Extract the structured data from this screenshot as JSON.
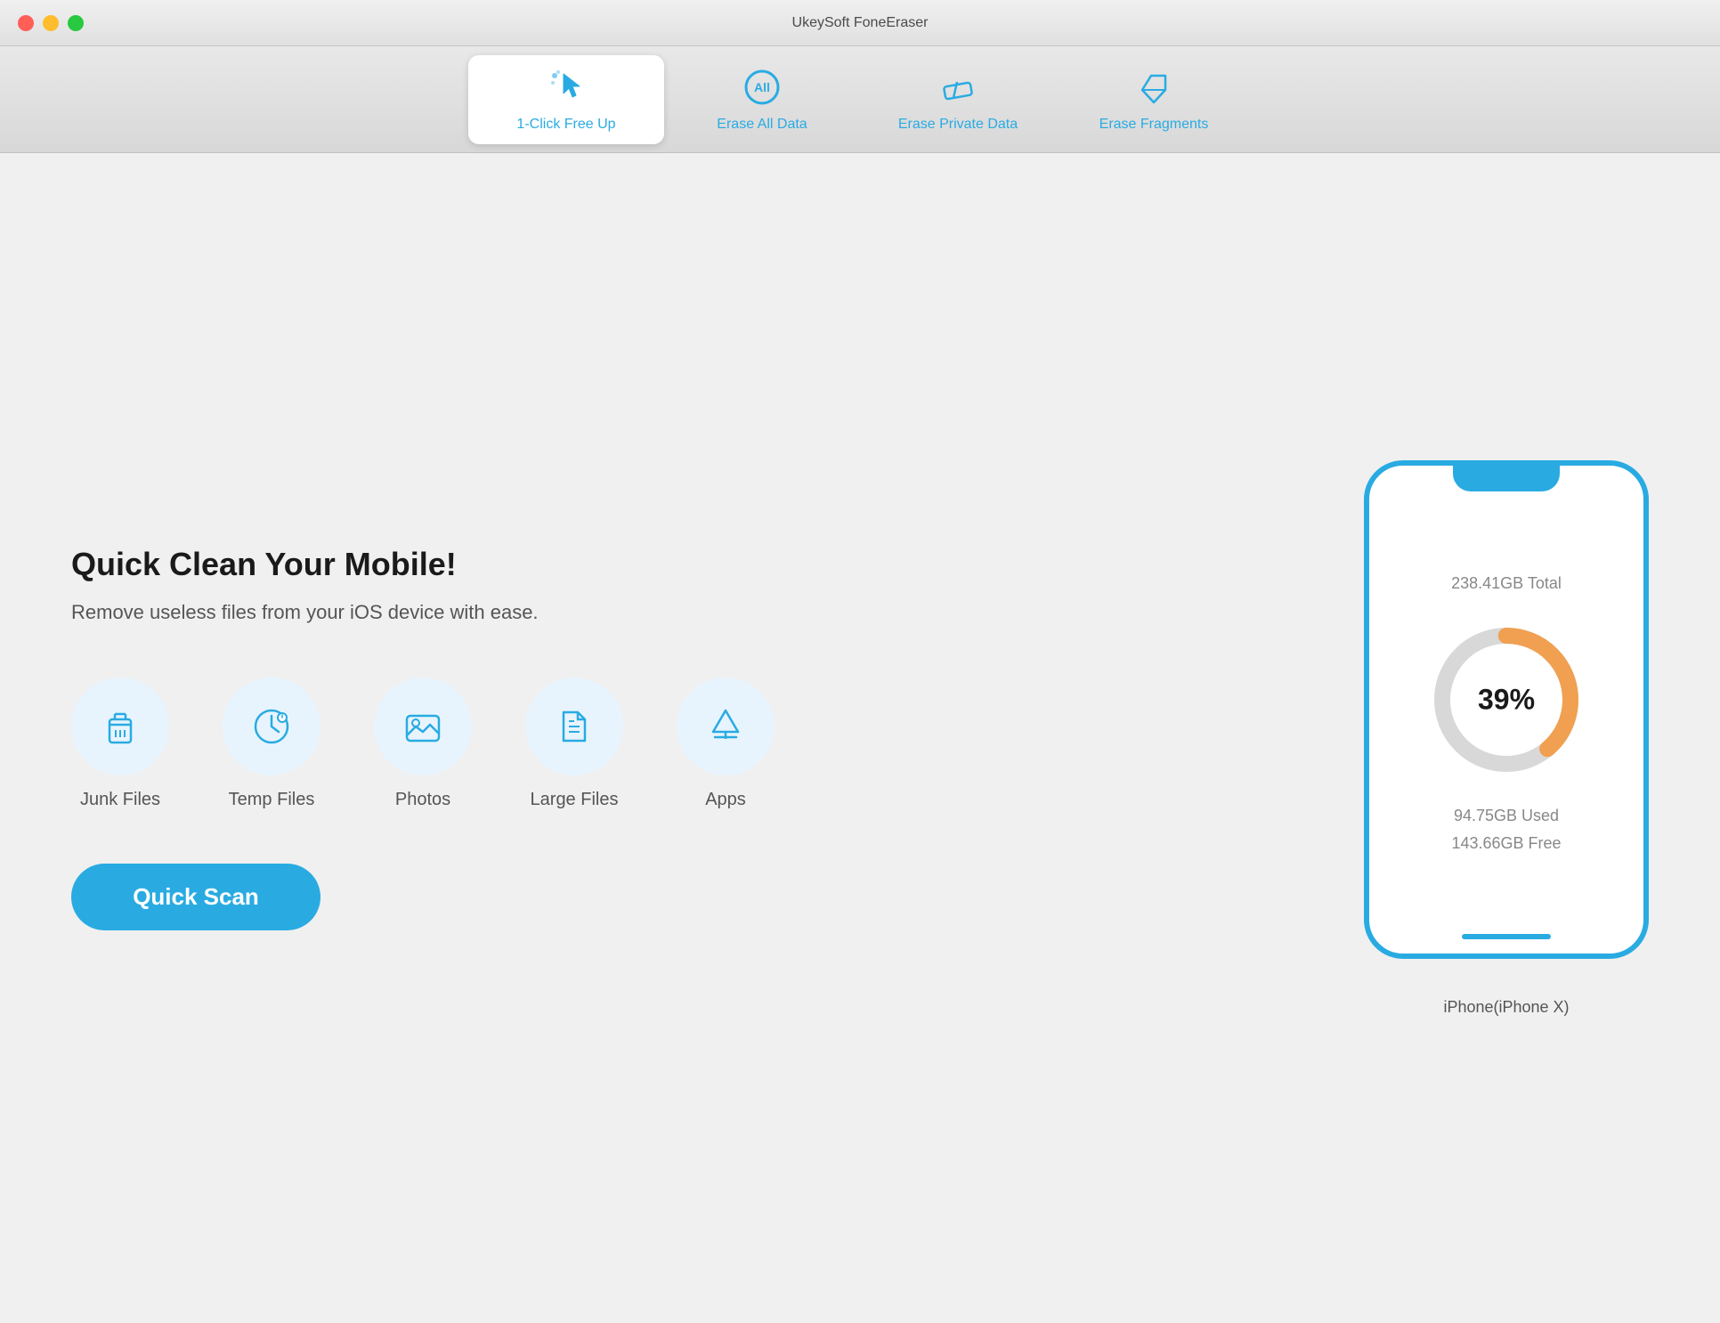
{
  "window": {
    "title": "UkeySoft FoneEraser"
  },
  "titlebar": {
    "close_label": "",
    "minimize_label": "",
    "maximize_label": ""
  },
  "nav": {
    "tabs": [
      {
        "id": "one-click",
        "label": "1-Click Free Up",
        "active": true
      },
      {
        "id": "erase-all",
        "label": "Erase All Data",
        "active": false
      },
      {
        "id": "erase-private",
        "label": "Erase Private Data",
        "active": false
      },
      {
        "id": "erase-fragments",
        "label": "Erase Fragments",
        "active": false
      }
    ]
  },
  "main": {
    "headline": "Quick Clean Your Mobile!",
    "subtitle": "Remove useless files from your iOS device with ease.",
    "icons": [
      {
        "id": "junk-files",
        "label": "Junk Files"
      },
      {
        "id": "temp-files",
        "label": "Temp Files"
      },
      {
        "id": "photos",
        "label": "Photos"
      },
      {
        "id": "large-files",
        "label": "Large Files"
      },
      {
        "id": "apps",
        "label": "Apps"
      }
    ],
    "scan_button_label": "Quick Scan"
  },
  "device": {
    "total": "238.41GB Total",
    "used": "94.75GB Used",
    "free": "143.66GB Free",
    "percent": 39,
    "percent_label": "39%",
    "name": "iPhone(iPhone X)",
    "donut": {
      "used_color": "#f0a050",
      "free_color": "#d8d8d8",
      "radius": 80,
      "stroke_width": 18
    }
  }
}
